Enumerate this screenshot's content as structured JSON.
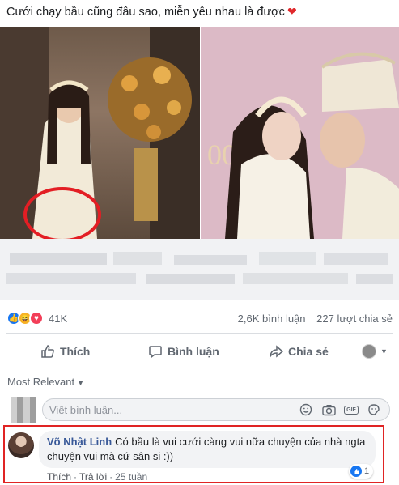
{
  "post": {
    "caption": "Cưới chạy bầu cũng đâu sao, miễn yêu nhau là được",
    "reaction_count": "41K",
    "comment_count": "2,6K bình luận",
    "share_count": "227 lượt chia sẻ"
  },
  "actions": {
    "like": "Thích",
    "comment": "Bình luận",
    "share": "Chia sẻ"
  },
  "comments": {
    "sort_label": "Most Relevant",
    "composer_placeholder": "Viết bình luận...",
    "items": [
      {
        "author": "Võ Nhật Linh",
        "text": "Có bầu là vui cưới càng vui nữa chuyện của nhà ngta chuyện vui mà cứ sân si :))",
        "like_label": "Thích",
        "reply_label": "Trả lời",
        "time": "25 tuần",
        "reaction_count": "1"
      }
    ]
  },
  "colors": {
    "accent": "#1877f2",
    "highlight": "#e02424",
    "author": "#385898"
  },
  "icons": [
    "heart-icon",
    "like-icon",
    "haha-icon",
    "love-icon",
    "comment-icon",
    "share-icon",
    "chevron-down-icon",
    "emoji-icon",
    "camera-icon",
    "gif-icon",
    "sticker-icon"
  ]
}
